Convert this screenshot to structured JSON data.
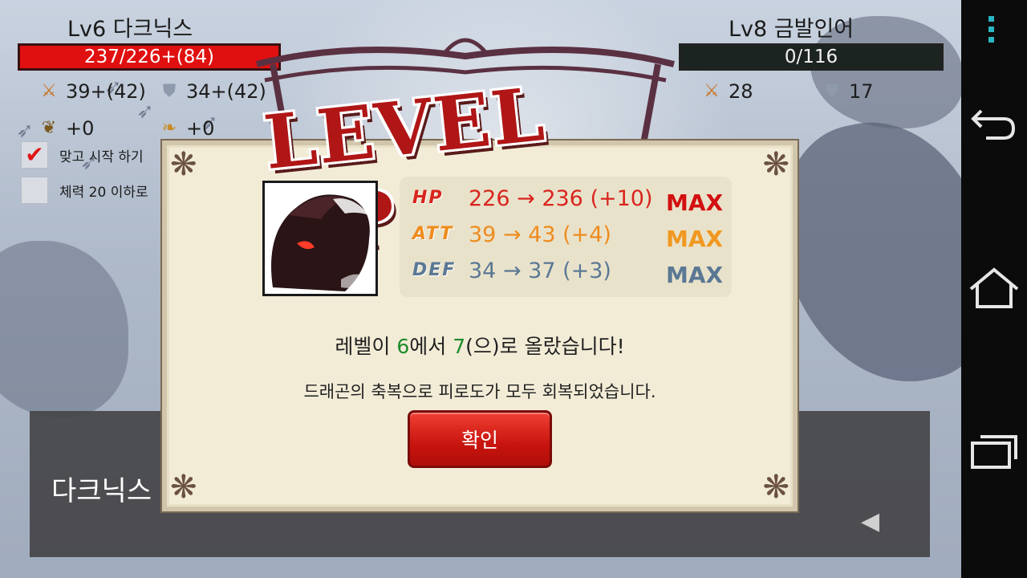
{
  "player": {
    "name": "Lv6 다크닉스",
    "hp": "237/226+(84)",
    "attack": "39+(42)",
    "defense": "34+(42)",
    "bonus1": "+0",
    "bonus2": "+0"
  },
  "options": [
    {
      "label": "맞고 시작 하기",
      "checked": "✔"
    },
    {
      "label": "체력 20 이하로",
      "checked": ""
    }
  ],
  "enemy": {
    "name": "Lv8 금발인어",
    "hp": "0/116",
    "attack": "28",
    "defense": "17"
  },
  "levelup": {
    "title": "LEVEL UP!",
    "stats": [
      {
        "label": "HP",
        "change": "226 → 236 (+10)",
        "max": "MAX"
      },
      {
        "label": "ATT",
        "change": "39 → 43 (+4)",
        "max": "MAX"
      },
      {
        "label": "DEF",
        "change": "34 → 37 (+3)",
        "max": "MAX"
      }
    ],
    "message_prefix": "레벨이 ",
    "from_level": "6",
    "message_mid": "에서 ",
    "to_level": "7",
    "message_suffix": "(으)로 올랐습니다!",
    "message2": "드래곤의 축복으로 피로도가 모두 회복되었습니다.",
    "confirm_label": "확인"
  },
  "bottom": {
    "speaker": "다크닉스",
    "next_icon": "◀"
  },
  "icons": {
    "sword": "⚔",
    "shield": "⛊",
    "horn": "❦",
    "feather": "❧"
  },
  "colors": {
    "hp_red": "#e01010",
    "title_red": "#b01616",
    "att_orange": "#ee8c1e",
    "def_blue": "#5a7894",
    "level_green": "#1d8b2b",
    "menu_teal": "#2ab5c4"
  }
}
